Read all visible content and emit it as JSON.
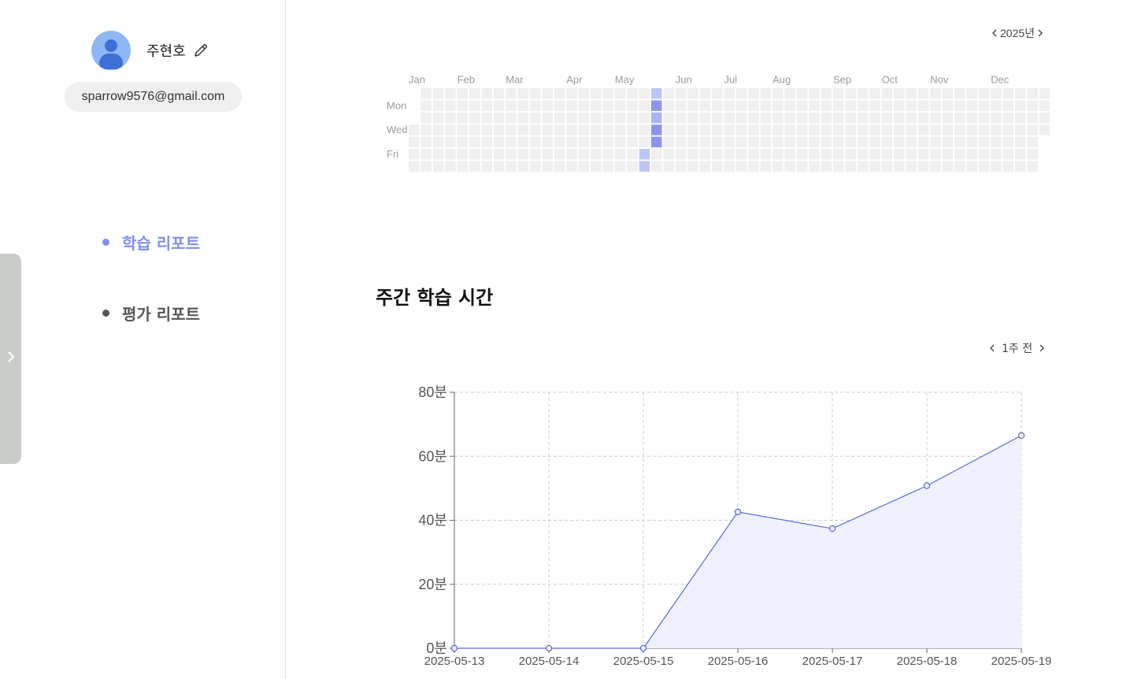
{
  "profile": {
    "name": "주현호",
    "email": "sparrow9576@gmail.com",
    "avatar_icon": "user-avatar-icon",
    "edit_icon": "pencil-icon"
  },
  "nav": {
    "items": [
      {
        "label": "학습 리포트",
        "active": true
      },
      {
        "label": "평가 리포트",
        "active": false
      }
    ]
  },
  "heatmap": {
    "year_label": "2025년",
    "months": [
      "Jan",
      "Feb",
      "Mar",
      "Apr",
      "May",
      "Jun",
      "Jul",
      "Aug",
      "Sep",
      "Oct",
      "Nov",
      "Dec"
    ],
    "day_labels": [
      "Mon",
      "Wed",
      "Fri"
    ],
    "active_days": [
      {
        "date": "2025-05-16",
        "level": 1
      },
      {
        "date": "2025-05-17",
        "level": 1
      },
      {
        "date": "2025-05-18",
        "level": 1
      },
      {
        "date": "2025-05-19",
        "level": 3
      },
      {
        "date": "2025-05-20",
        "level": 2
      },
      {
        "date": "2025-05-21",
        "level": 3
      },
      {
        "date": "2025-05-22",
        "level": 3
      }
    ],
    "colors": {
      "empty": "#efefef",
      "level1": "#bcc4f8",
      "level2": "#aab3f6",
      "level3": "#8a95ee"
    }
  },
  "weekly": {
    "title": "주간 학습 시간",
    "range_label": "1주 전"
  },
  "chart_data": {
    "type": "area",
    "x": [
      "2025-05-13",
      "2025-05-14",
      "2025-05-15",
      "2025-05-16",
      "2025-05-17",
      "2025-05-18",
      "2025-05-19"
    ],
    "series": [
      {
        "values": [
          0,
          0,
          0,
          42.6,
          37.4,
          50.8,
          66.5
        ]
      }
    ],
    "y_ticks": [
      "0분",
      "20분",
      "40분",
      "60분",
      "80분"
    ],
    "ylim": [
      0,
      80
    ],
    "grid": true,
    "line_color": "#5a6ad6",
    "fill_color": "#eef0fd"
  }
}
